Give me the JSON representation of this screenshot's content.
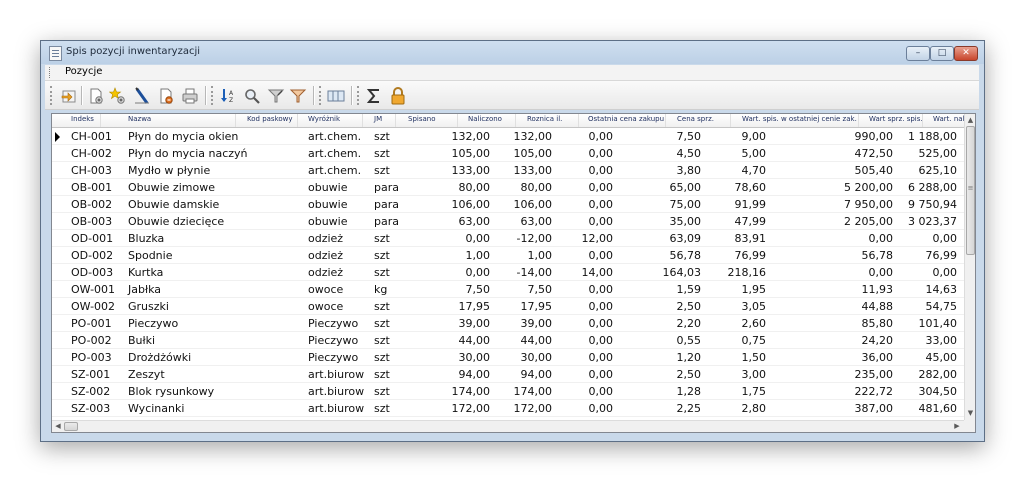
{
  "window": {
    "title": "Spis pozycji inwentaryzacji",
    "min_glyph": "–",
    "max_glyph": "□",
    "close_glyph": "✕"
  },
  "menu": {
    "items": [
      "Pozycje"
    ]
  },
  "toolbar": {
    "buttons": [
      "import-icon",
      "new-document-icon",
      "add-star-icon",
      "edit-pencil-icon",
      "delete-icon",
      "print-icon",
      "sort-az-icon",
      "search-icon",
      "filter-icon",
      "filter-clear-icon",
      "columns-icon",
      "sum-icon",
      "lock-icon"
    ]
  },
  "table": {
    "columns": [
      "Indeks",
      "Nazwa",
      "Kod paskowy",
      "Wyróżnik",
      "JM",
      "Spisano",
      "Naliczono",
      "Roznica il.",
      "Ostatnia cena zakupu",
      "Cena sprz.",
      "Wart. spis. w ostatniej cenie zak.",
      "Wart sprz. spis.",
      "Wart. nal."
    ],
    "rows": [
      [
        "CH-001",
        "Płyn do mycia okien",
        "",
        "art.chem.",
        "szt",
        "132,00",
        "132,00",
        "0,00",
        "7,50",
        "9,00",
        "990,00",
        "1 188,00"
      ],
      [
        "CH-002",
        "Płyn do mycia naczyń",
        "",
        "art.chem.",
        "szt",
        "105,00",
        "105,00",
        "0,00",
        "4,50",
        "5,00",
        "472,50",
        "525,00"
      ],
      [
        "CH-003",
        "Mydło w płynie",
        "",
        "art.chem.",
        "szt",
        "133,00",
        "133,00",
        "0,00",
        "3,80",
        "4,70",
        "505,40",
        "625,10"
      ],
      [
        "OB-001",
        "Obuwie zimowe",
        "",
        "obuwie",
        "para",
        "80,00",
        "80,00",
        "0,00",
        "65,00",
        "78,60",
        "5 200,00",
        "6 288,00"
      ],
      [
        "OB-002",
        "Obuwie damskie",
        "",
        "obuwie",
        "para",
        "106,00",
        "106,00",
        "0,00",
        "75,00",
        "91,99",
        "7 950,00",
        "9 750,94"
      ],
      [
        "OB-003",
        "Obuwie dziecięce",
        "",
        "obuwie",
        "para",
        "63,00",
        "63,00",
        "0,00",
        "35,00",
        "47,99",
        "2 205,00",
        "3 023,37"
      ],
      [
        "OD-001",
        "Bluzka",
        "",
        "odzież",
        "szt",
        "0,00",
        "-12,00",
        "12,00",
        "63,09",
        "83,91",
        "0,00",
        "0,00"
      ],
      [
        "OD-002",
        "Spodnie",
        "",
        "odzież",
        "szt",
        "1,00",
        "1,00",
        "0,00",
        "56,78",
        "76,99",
        "56,78",
        "76,99"
      ],
      [
        "OD-003",
        "Kurtka",
        "",
        "odzież",
        "szt",
        "0,00",
        "-14,00",
        "14,00",
        "164,03",
        "218,16",
        "0,00",
        "0,00"
      ],
      [
        "OW-001",
        "Jabłka",
        "",
        "owoce",
        "kg",
        "7,50",
        "7,50",
        "0,00",
        "1,59",
        "1,95",
        "11,93",
        "14,63"
      ],
      [
        "OW-002",
        "Gruszki",
        "",
        "owoce",
        "szt",
        "17,95",
        "17,95",
        "0,00",
        "2,50",
        "3,05",
        "44,88",
        "54,75"
      ],
      [
        "PO-001",
        "Pieczywo",
        "",
        "Pieczywo",
        "szt",
        "39,00",
        "39,00",
        "0,00",
        "2,20",
        "2,60",
        "85,80",
        "101,40"
      ],
      [
        "PO-002",
        "Bułki",
        "",
        "Pieczywo",
        "szt",
        "44,00",
        "44,00",
        "0,00",
        "0,55",
        "0,75",
        "24,20",
        "33,00"
      ],
      [
        "PO-003",
        "Drożdżówki",
        "",
        "Pieczywo",
        "szt",
        "30,00",
        "30,00",
        "0,00",
        "1,20",
        "1,50",
        "36,00",
        "45,00"
      ],
      [
        "SZ-001",
        "Zeszyt",
        "",
        "art.biurow",
        "szt",
        "94,00",
        "94,00",
        "0,00",
        "2,50",
        "3,00",
        "235,00",
        "282,00"
      ],
      [
        "SZ-002",
        "Blok rysunkowy",
        "",
        "art.biurow",
        "szt",
        "174,00",
        "174,00",
        "0,00",
        "1,28",
        "1,75",
        "222,72",
        "304,50"
      ],
      [
        "SZ-003",
        "Wycinanki",
        "",
        "art.biurow",
        "szt",
        "172,00",
        "172,00",
        "0,00",
        "2,25",
        "2,80",
        "387,00",
        "481,60"
      ]
    ],
    "selected_row": 0
  },
  "scrollbars": {
    "up": "▲",
    "down": "▼",
    "left": "◀",
    "right": "▶",
    "grip": "≡"
  }
}
